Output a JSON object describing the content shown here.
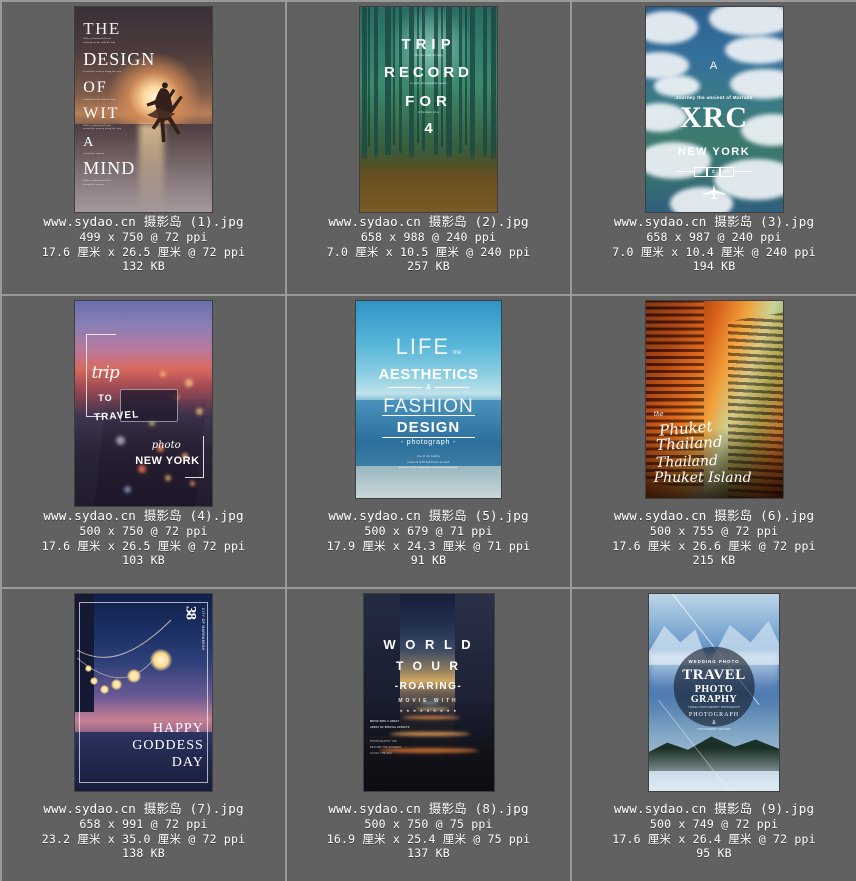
{
  "window": {
    "background_color": "#616161",
    "grid_line_color": "#9a9a9a",
    "columns": 3,
    "rows": 3
  },
  "files": [
    {
      "filename": "www.sydao.cn 摄影岛 (1).jpg",
      "pixels": "499 x 750 @ 72 ppi",
      "physical": "17.6 厘米 x 26.5 厘米 @ 72 ppi",
      "filesize": "132 KB",
      "thumb": {
        "id": "ballerina-sunset-poster",
        "lines": [
          "THE",
          "DESIGN",
          "OF",
          "WIT",
          "A",
          "MIND"
        ],
        "sub": [
          "With a sentimental heart",
          "walking on the road his trip",
          "record the scenery along the way",
          "walking on the road his trip",
          "With a sentimental heart",
          "record the scenery along the way",
          "record the scenery",
          "With a sentimental heart",
          "record the scenery"
        ]
      }
    },
    {
      "filename": "www.sydao.cn 摄影岛 (2).jpg",
      "pixels": "658 x 988 @ 240 ppi",
      "physical": "7.0 厘米 x 10.5 厘米 @ 240 ppi",
      "filesize": "257 KB",
      "thumb": {
        "id": "forest-trip-record-poster",
        "lines": [
          "TRIP",
          "RECORD",
          "FOR",
          "4"
        ],
        "sub": [
          "Tour the walk city king",
          "on point photographer search",
          "of flourless force"
        ]
      }
    },
    {
      "filename": "www.sydao.cn 摄影岛 (3).jpg",
      "pixels": "658 x 987 @ 240 ppi",
      "physical": "7.0 厘米 x 10.4 厘米 @ 240 ppi",
      "filesize": "194 KB",
      "thumb": {
        "id": "aerial-clouds-xrc-poster",
        "a": "A",
        "tagline": "Journey the ancient of Marrake",
        "big": "XRC",
        "city": "NEW YORK",
        "boxes": [
          "c",
          "d",
          "m"
        ],
        "icon": "airplane-icon"
      }
    },
    {
      "filename": "www.sydao.cn 摄影岛 (4).jpg",
      "pixels": "500 x 750 @ 72 ppi",
      "physical": "17.6 厘米 x 26.5 厘米 @ 72 ppi",
      "filesize": "103 KB",
      "thumb": {
        "id": "bokeh-city-trip-travel-poster",
        "script1": "trip",
        "to": "TO",
        "travel": "TRAVEL",
        "script2": "photo",
        "city": "NEW YORK"
      }
    },
    {
      "filename": "www.sydao.cn 摄影岛 (5).jpg",
      "pixels": "500 x 679 @ 71 ppi",
      "physical": "17.9 厘米 x 24.3 厘米 @ 71 ppi",
      "filesize": "91 KB",
      "thumb": {
        "id": "ocean-life-aesthetics-poster",
        "life": "LIFE",
        "the": "the",
        "aesthetics": "AESTHETICS",
        "amp": "&",
        "fashion": "FASHION",
        "design": "DESIGN",
        "photograph": "- photograph -",
        "body": [
          "One of the leading",
          "pioneers of British Photo Journal!",
          "A group of TV cameramen and press photograp"
        ]
      }
    },
    {
      "filename": "www.sydao.cn 摄影岛 (6).jpg",
      "pixels": "500 x 755 @ 72 ppi",
      "physical": "17.6 厘米 x 26.6 厘米 @ 72 ppi",
      "filesize": "215 KB",
      "thumb": {
        "id": "orange-buildings-phuket-poster",
        "the": "the",
        "l1": "Phuket",
        "l2": "Thailand",
        "l3": "Thailand",
        "l4": "Phuket  Island"
      }
    },
    {
      "filename": "www.sydao.cn 摄影岛 (7).jpg",
      "pixels": "658 x 991 @ 72 ppi",
      "physical": "23.2 厘米 x 35.0 厘米 @ 72 ppi",
      "filesize": "138 KB",
      "thumb": {
        "id": "string-lights-happy-goddess-day-poster",
        "number": "38",
        "vertical": "CITY OF MARRAKESH",
        "lines": [
          "HAPPY",
          "GODDESS",
          "DAY"
        ]
      }
    },
    {
      "filename": "www.sydao.cn 摄影岛 (8).jpg",
      "pixels": "500 x 750 @ 75 ppi",
      "physical": "16.9 厘米 x 25.4 厘米 @ 75 ppi",
      "filesize": "137 KB",
      "thumb": {
        "id": "city-street-world-tour-poster",
        "world": "W O R L D",
        "tour": "T O U R",
        "roaring": "-ROARING-",
        "movie": "MOVIE WITH",
        "stars": "★ ★ ★ ★ ★ ★ ★ ★ ★",
        "body": [
          "MOVIE WITH A GREAT",
          "ARRAY OF SPECIAL EFFECTS"
        ],
        "small": [
          "PHOTOGRAPHY THE",
          "RECORD THE SCENERY",
          "ALONG THE WAY"
        ]
      }
    },
    {
      "filename": "www.sydao.cn 摄影岛 (9).jpg",
      "pixels": "500 x 749 @ 72 ppi",
      "physical": "17.6 厘米 x 26.4 厘米 @ 72 ppi",
      "filesize": "95 KB",
      "thumb": {
        "id": "mountains-travel-photography-badge-poster",
        "kicker": "WEDDING PHOTO",
        "travel": "TRAVEL",
        "photo": "PHOTO",
        "graphy": "GRAPHY",
        "rule": "TRAVEL PHOTOGRAPHY PHOTOGRAPH",
        "photograph": "PHOTOGRAPH",
        "amp": "&",
        "foot": "PHOTOGRAPHY RECORD"
      }
    }
  ]
}
